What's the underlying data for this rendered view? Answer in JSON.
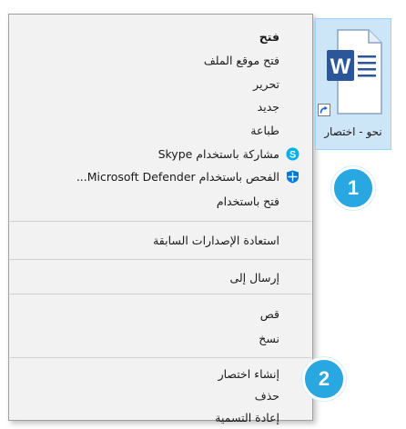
{
  "file": {
    "label": "نحو - اختصار",
    "icon": "word-document-icon"
  },
  "menu": {
    "groups": [
      [
        {
          "label": "فتح",
          "bold": true
        },
        {
          "label": "فتح موقع الملف"
        },
        {
          "label": "تحرير"
        },
        {
          "label": "جديد"
        },
        {
          "label": "طباعة"
        },
        {
          "label": "مشاركة باستخدام Skype",
          "icon": "skype-icon"
        },
        {
          "label": "الفحص باستخدام Microsoft Defender...",
          "icon": "defender-shield-icon"
        },
        {
          "label": "فتح باستخدام"
        }
      ],
      [
        {
          "label": "استعادة الإصدارات السابقة"
        }
      ],
      [
        {
          "label": "إرسال إلى"
        }
      ],
      [
        {
          "label": "قص"
        },
        {
          "label": "نسخ"
        }
      ],
      [
        {
          "label": "إنشاء اختصار"
        },
        {
          "label": "حذف"
        },
        {
          "label": "إعادة التسمية"
        }
      ]
    ]
  },
  "callouts": [
    "1",
    "2"
  ],
  "colors": {
    "callout": "#28a7e0",
    "menu_bg": "#f2f2f2",
    "selection": "#cde6f7",
    "word_blue": "#2b579a",
    "skype": "#00aff0",
    "defender": "#0078d4"
  }
}
